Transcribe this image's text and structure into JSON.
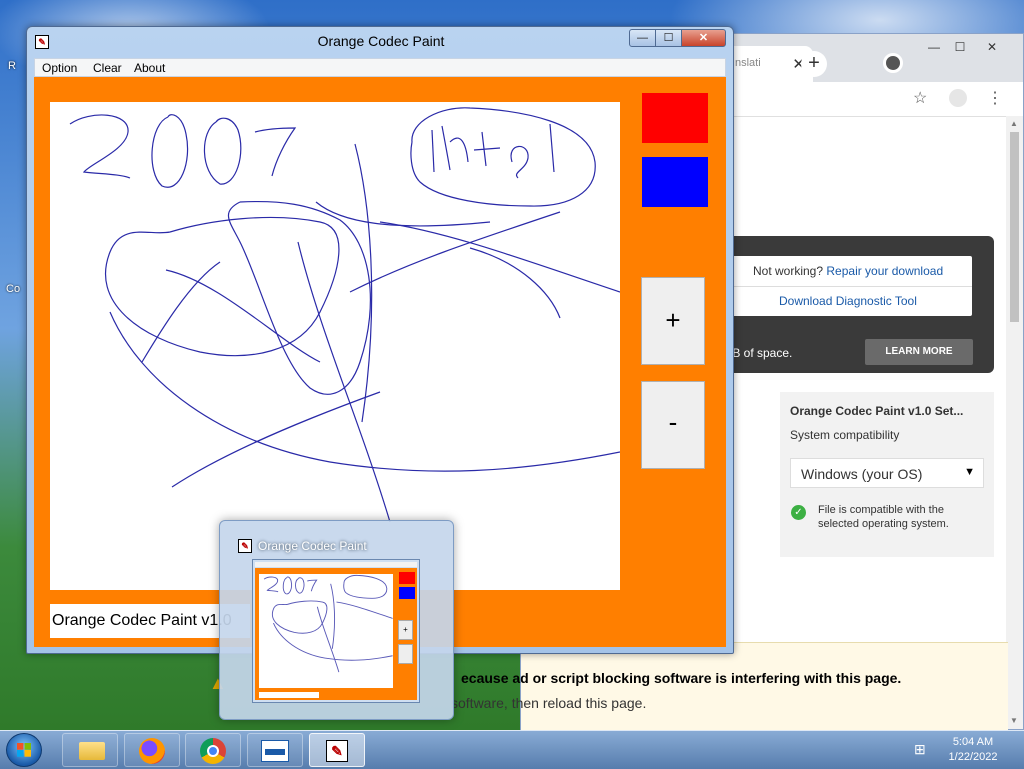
{
  "desktop": {
    "left_sliver_1": "R",
    "left_sliver_2": "Co"
  },
  "browser": {
    "tab_label": "nslati",
    "tab_close": "✕",
    "new_tab": "+",
    "win_min": "—",
    "win_max": "☐",
    "win_close": "✕",
    "bookmark_icon": "☆",
    "profile_icon": "person-icon",
    "menu_icon": "⋮",
    "not_working_prefix": "Not working?",
    "repair_link": "Repair your download",
    "diagnostic_link": "Download Diagnostic Tool",
    "tb_space_text": "TB of space.",
    "learn_more": "LEARN MORE",
    "setup_title": "Orange Codec Paint v1.0 Set...",
    "system_compat": "System compatibility",
    "os_select_value": "Windows (your OS)",
    "compat_message": "File is compatible with the selected operating system.",
    "notice_line1": "ecause ad or script blocking software is interfering with this page.",
    "notice_line2": "software, then reload this page."
  },
  "paint_window": {
    "title": "Orange Codec Paint",
    "btn_min": "—",
    "btn_max": "☐",
    "btn_close": "✕",
    "menu": [
      "Option",
      "Clear",
      "About"
    ],
    "status_text": "Orange Codec Paint v1.0",
    "plus_label": "+",
    "minus_label": "-",
    "colors": {
      "red": "#ff0000",
      "blue": "#0000ff",
      "background": "#ff7f00"
    }
  },
  "thumbnail": {
    "title": "Orange Codec Paint",
    "plus": "+",
    "minus": ""
  },
  "taskbar": {
    "items": [
      "windows-explorer",
      "firefox",
      "chrome",
      "setup-installer",
      "orange-codec-paint"
    ],
    "active_item": "orange-codec-paint",
    "time": "5:04 AM",
    "date": "1/22/2022"
  }
}
